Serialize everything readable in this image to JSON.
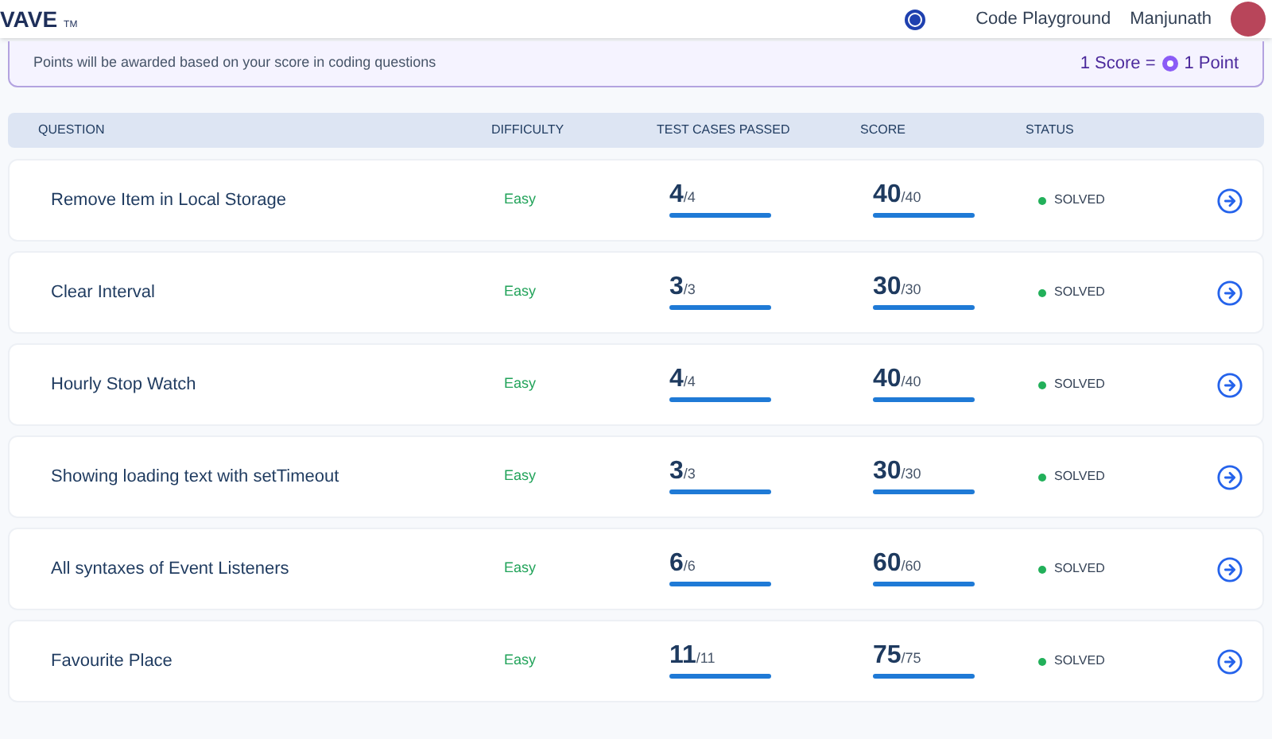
{
  "header": {
    "logo": "VAVE",
    "logo_mark": "TM",
    "nav_link": "Code Playground",
    "user_name": "Manjunath"
  },
  "banner": {
    "message": "Points will be awarded based on your score in coding questions",
    "conversion_left": "1 Score =",
    "conversion_right": "1 Point"
  },
  "table": {
    "columns": [
      "QUESTION",
      "DIFFICULTY",
      "TEST CASES PASSED",
      "SCORE",
      "STATUS"
    ],
    "rows": [
      {
        "question": "Remove Item in Local Storage",
        "difficulty": "Easy",
        "passed": "4",
        "total": "/4",
        "score": "40",
        "max_score": "/40",
        "status": "SOLVED",
        "color": "#22b05a"
      },
      {
        "question": "Clear Interval",
        "difficulty": "Easy",
        "passed": "3",
        "total": "/3",
        "score": "30",
        "max_score": "/30",
        "status": "SOLVED",
        "color": "#22b05a"
      },
      {
        "question": "Hourly Stop Watch",
        "difficulty": "Easy",
        "passed": "4",
        "total": "/4",
        "score": "40",
        "max_score": "/40",
        "status": "SOLVED",
        "color": "#22b05a"
      },
      {
        "question": "Showing loading text with setTimeout",
        "difficulty": "Easy",
        "passed": "3",
        "total": "/3",
        "score": "30",
        "max_score": "/30",
        "status": "SOLVED",
        "color": "#22b05a"
      },
      {
        "question": "All syntaxes of Event Listeners",
        "difficulty": "Easy",
        "passed": "6",
        "total": "/6",
        "score": "60",
        "max_score": "/60",
        "status": "SOLVED",
        "color": "#22b05a"
      },
      {
        "question": "Favourite Place",
        "difficulty": "Easy",
        "passed": "11",
        "total": "/11",
        "score": "75",
        "max_score": "/75",
        "status": "SOLVED",
        "color": "#22b05a"
      }
    ]
  }
}
